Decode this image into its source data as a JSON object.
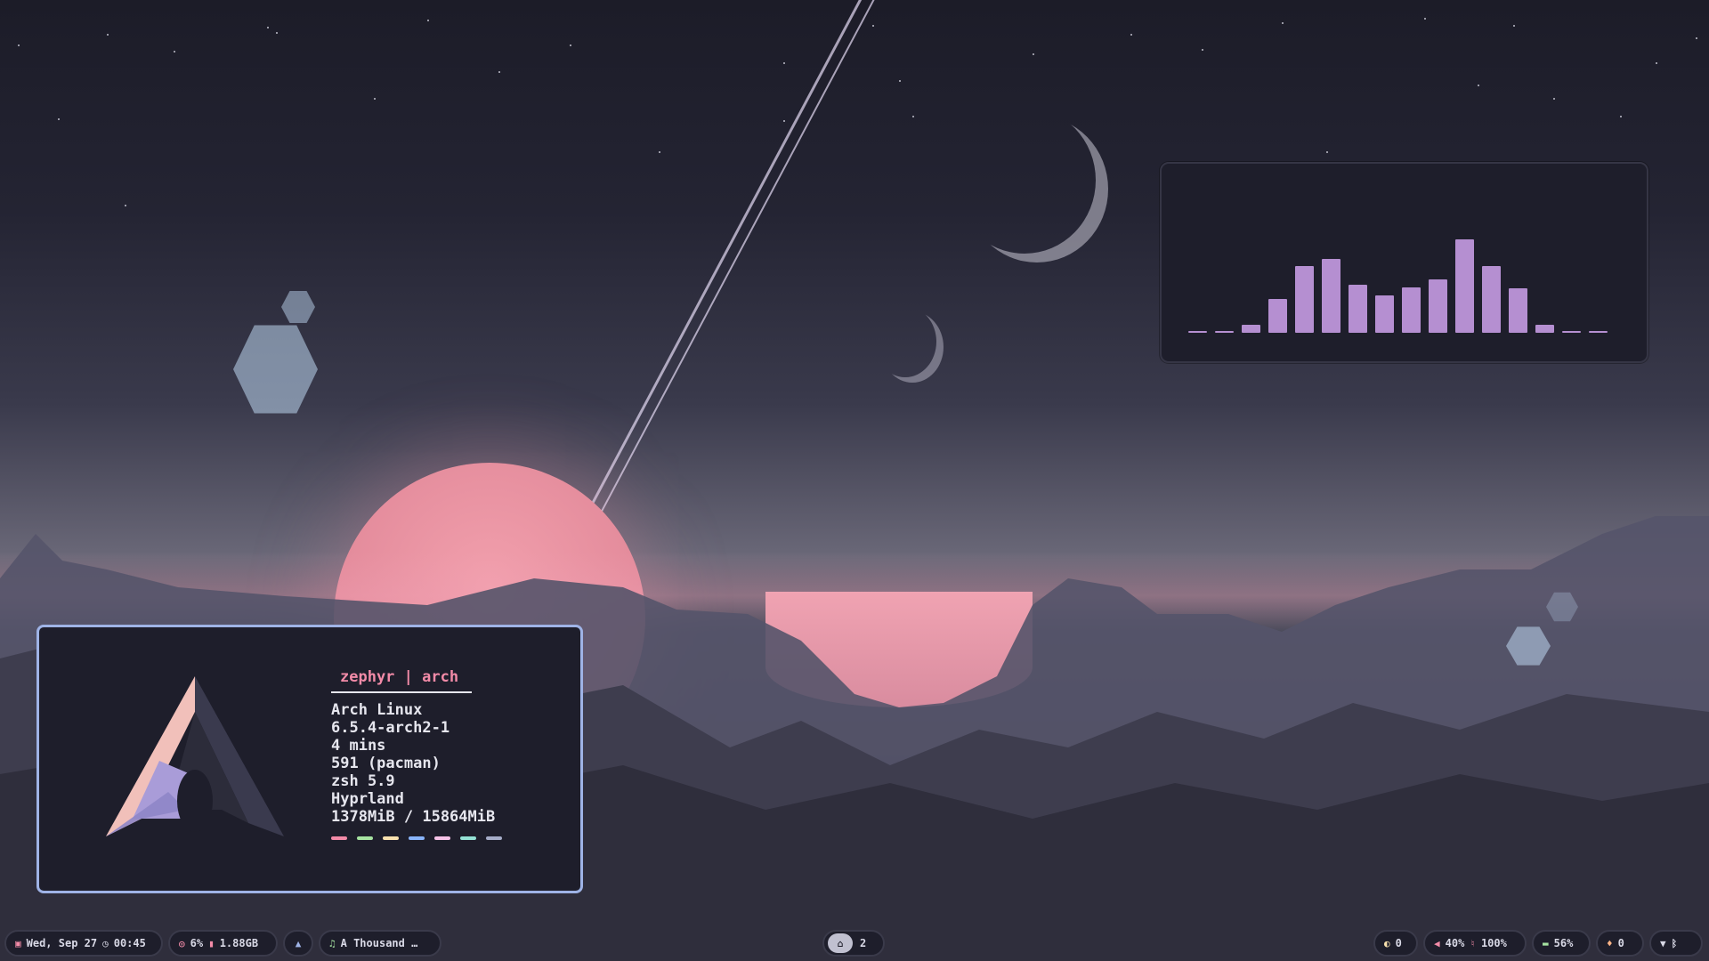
{
  "fetch": {
    "title": "zephyr | arch",
    "os": "Arch Linux",
    "kernel": "6.5.4-arch2-1",
    "uptime": "4 mins",
    "packages": "591 (pacman)",
    "shell": "zsh 5.9",
    "wm": "Hyprland",
    "memory": "1378MiB / 15864MiB",
    "swatch_colors": [
      "#f38ba8",
      "#a6e3a1",
      "#f9e2af",
      "#89b4fa",
      "#f5c2e7",
      "#94e2d5",
      "#a6adc8"
    ]
  },
  "visualizer": {
    "levels": [
      0.01,
      0.01,
      0.06,
      0.25,
      0.5,
      0.55,
      0.36,
      0.28,
      0.34,
      0.4,
      0.7,
      0.5,
      0.33,
      0.06,
      0.01,
      0.01
    ],
    "bar_color": "#b58fd1"
  },
  "statusbar": {
    "clock": {
      "icon": "calendar-icon",
      "date": "Wed, Sep 27",
      "time_icon": "clock-icon",
      "time": "00:45"
    },
    "system": {
      "cpu_icon": "cpu-icon",
      "cpu": "6%",
      "mem_icon": "memory-icon",
      "mem": "1.88GB"
    },
    "launcher": {
      "icon": "arch-logo-icon"
    },
    "media": {
      "icon": "music-note-icon",
      "title": "A Thousand …"
    },
    "workspace": {
      "icon": "home-icon",
      "label": "2"
    },
    "idle": {
      "icon": "moon-icon",
      "value": "0"
    },
    "audio": {
      "speaker_icon": "speaker-icon",
      "volume": "40%",
      "mic_icon": "microphone-icon",
      "mic": "100%"
    },
    "battery": {
      "icon": "battery-icon",
      "value": "56%"
    },
    "notifications": {
      "icon": "bell-icon",
      "value": "0"
    },
    "connectivity": {
      "wifi_icon": "wifi-icon",
      "bt_icon": "bluetooth-icon"
    }
  }
}
